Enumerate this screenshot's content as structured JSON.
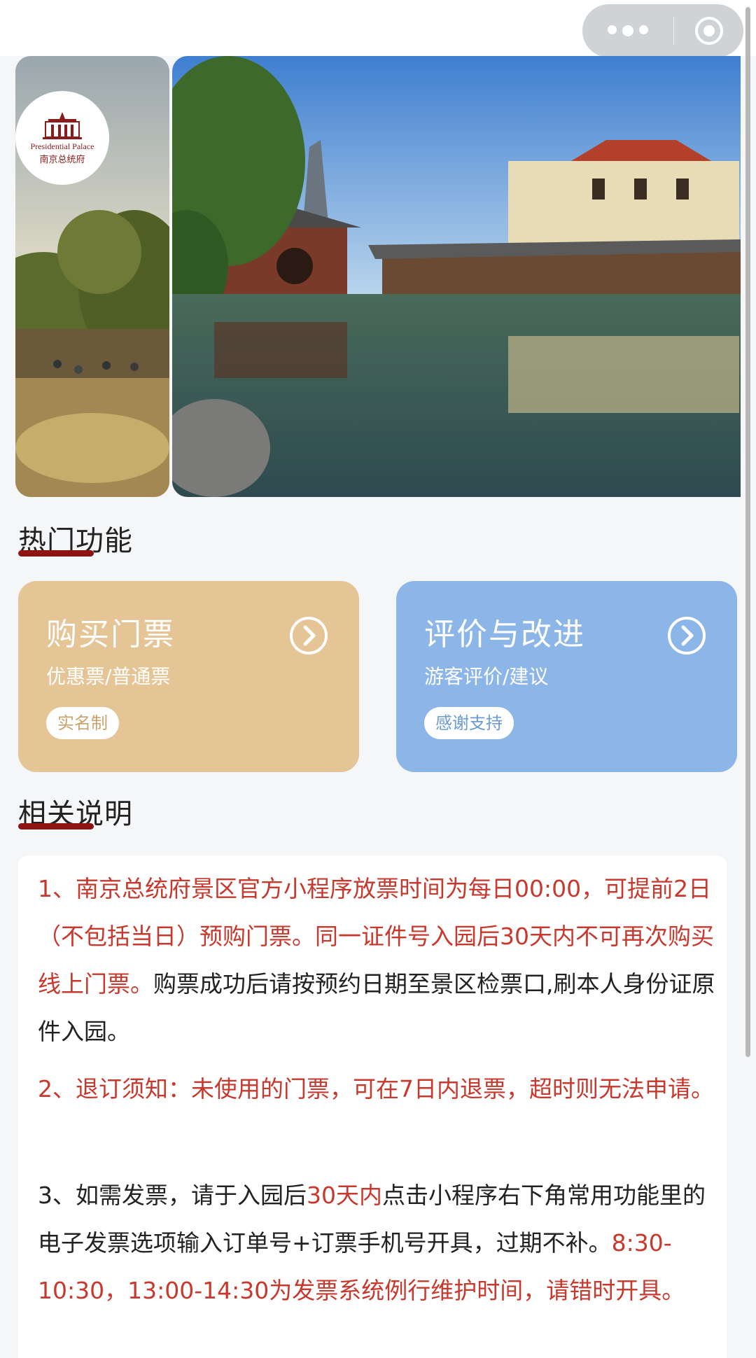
{
  "logo": {
    "en": "Presidential Palace",
    "cn": "南京总统府"
  },
  "sections": {
    "hot": "热门功能",
    "notes": "相关说明"
  },
  "cards": {
    "buy": {
      "title": "购买门票",
      "subtitle": "优惠票/普通票",
      "badge": "实名制",
      "color": "#e5c496"
    },
    "review": {
      "title": "评价与改进",
      "subtitle": "游客评价/建议",
      "badge": "感谢支持",
      "color": "#8db6e8"
    }
  },
  "notes": {
    "p1_red": "1、南京总统府景区官方小程序放票时间为每日00:00，可提前2日（不包括当日）预购门票。同一证件号入园后30天内不可再次购买线上门票。",
    "p1_dark": "购票成功后请按预约日期至景区检票口,刷本人身份证原件入园。",
    "p2_red": "2、退订须知：未使用的门票，可在7日内退票，超时则无法申请。",
    "p3_a": "3、如需发票，请于入园后",
    "p3_b": "30天内",
    "p3_c": "点击小程序右下角常用功能里的电子发票选项输入订单号+订票手机号开具，过期不补。",
    "p3_red": "8:30-10:30，13:00-14:30为发票系统例行维护时间，请错时开具。"
  },
  "colors": {
    "accent_red": "#c8382c",
    "underline": "#8e1414"
  },
  "icons": {
    "more": "more-dots-icon",
    "close": "target-circle-icon",
    "arrow": "chevron-right-circle-icon"
  }
}
